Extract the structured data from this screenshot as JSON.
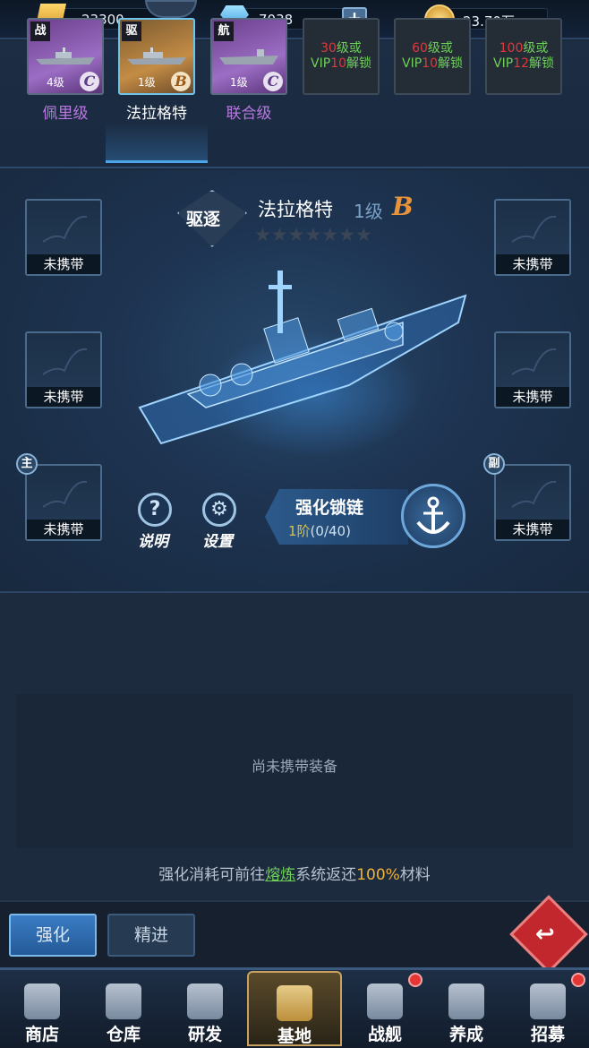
{
  "resources": {
    "power": "23300",
    "diamonds": "7038",
    "plus": "+",
    "gold": "23.70万"
  },
  "ships": [
    {
      "type": "战",
      "level": "4级",
      "grade": "C",
      "name": "佩里级"
    },
    {
      "type": "驱",
      "level": "1级",
      "grade": "B",
      "name": "法拉格特"
    },
    {
      "type": "航",
      "level": "1级",
      "grade": "C",
      "name": "联合级"
    }
  ],
  "locked": [
    {
      "a": "30",
      "b": "级或",
      "c": "VIP",
      "d": "10",
      "e": "解锁"
    },
    {
      "a": "60",
      "b": "级或",
      "c": "VIP",
      "d": "10",
      "e": "解锁"
    },
    {
      "a": "100",
      "b": "级或",
      "c": "VIP",
      "d": "12",
      "e": "解锁"
    }
  ],
  "detail": {
    "type": "驱逐",
    "name": "法拉格特",
    "level": "1级",
    "grade": "B",
    "stars": "★★★★★★★"
  },
  "slots": {
    "empty_label": "未携带",
    "main": "主",
    "sub": "副"
  },
  "buttons": {
    "help": "说明",
    "settings": "设置",
    "help_icon": "?",
    "settings_icon": "⚙"
  },
  "chain": {
    "title": "强化锁链",
    "level": "1阶",
    "progress": "(0/40)"
  },
  "equip": {
    "empty": "尚未携带装备"
  },
  "note": {
    "pre": "强化消耗可前往",
    "link": "熔炼",
    "mid": "系统返还",
    "pct": "100%",
    "post": "材料"
  },
  "actions": {
    "enhance": "强化",
    "refine": "精进"
  },
  "nav": [
    "商店",
    "仓库",
    "研发",
    "基地",
    "战舰",
    "养成",
    "招募"
  ],
  "colors": {
    "accent": "#4aa6e6",
    "grade_b": "#e8933a",
    "unlock_red": "#e0383a",
    "unlock_green": "#6fcf5a"
  }
}
